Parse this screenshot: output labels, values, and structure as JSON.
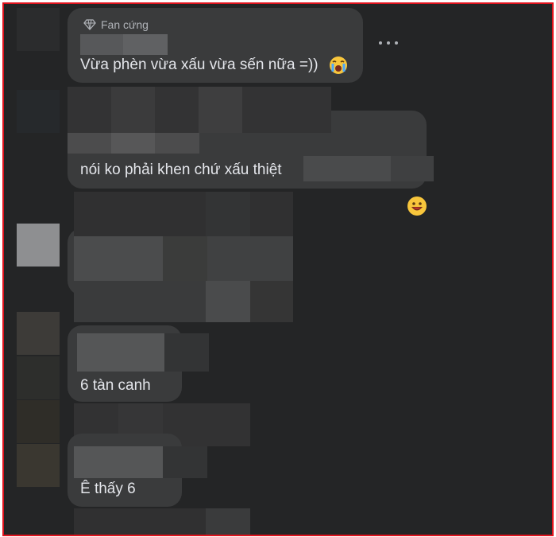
{
  "comments": [
    {
      "badge": "Fan cứng",
      "text": "Vừa phèn vừa xấu vừa sến nữa =))",
      "emoji_icon": "crying-face-icon"
    },
    {
      "text": "nói ko phải khen chứ xấu thiệt",
      "reaction_icon": "grinning-face-icon"
    },
    {
      "text": "6 tàn canh"
    },
    {
      "text": "Ê thấy 6"
    }
  ],
  "icons": {
    "more": "more-options-icon",
    "badge": "diamond-icon"
  },
  "colors": {
    "background": "#242526",
    "bubble": "#3a3b3c",
    "text": "#e4e6eb",
    "secondary_text": "#b0b3b8",
    "frame_border": "#e0141e"
  }
}
